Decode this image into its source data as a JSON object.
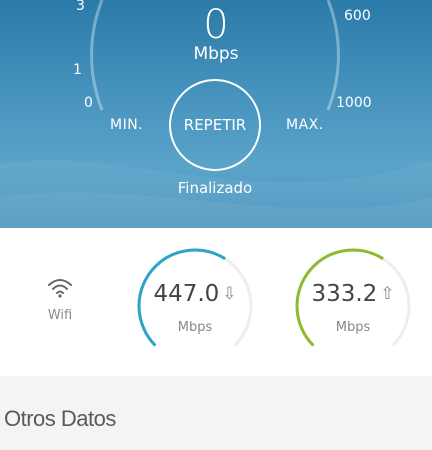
{
  "speedometer": {
    "value": "0",
    "unit": "Mbps",
    "scale_labels": {
      "s0": "0",
      "s1": "1",
      "s3": "3",
      "s600": "600",
      "s1000": "1000"
    },
    "min_label": "MIN.",
    "max_label": "MAX.",
    "repeat_label": "REPETIR",
    "status": "Finalizado"
  },
  "results": {
    "connection_label": "Wifi",
    "download": {
      "value": "447.0",
      "unit": "Mbps",
      "arrow": "⇩",
      "fill": 0.62,
      "color": "#2aa4c9"
    },
    "upload": {
      "value": "333.2",
      "unit": "Mbps",
      "arrow": "⇧",
      "fill": 0.62,
      "color": "#8cbb2c"
    }
  },
  "other": {
    "title": "Otros Datos"
  },
  "colors": {
    "accent_download": "#2aa4c9",
    "accent_upload": "#8cbb2c"
  }
}
